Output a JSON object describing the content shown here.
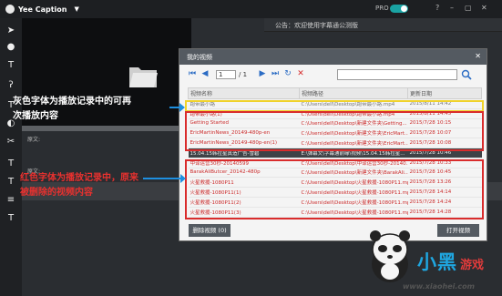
{
  "app": {
    "title": "Yee Caption",
    "pro_label": "PRO"
  },
  "notice": "公告：欢迎使用字幕通公测版",
  "subtitle_lines": {
    "line1": "原文:",
    "line2": "原文:"
  },
  "dialog": {
    "title": "我的视频",
    "page_value": "1",
    "page_total": "/ 1",
    "search_placeholder": "",
    "columns": [
      "视频名称",
      "视频路径",
      "更新日期"
    ],
    "rows": [
      {
        "name": "跑带最小路",
        "path": "C:\\Users\\dell\\Desktop\\跑带最小路.mp4",
        "date": "2015/8/11 14:42",
        "style": "gray"
      },
      {
        "name": "跑带最小路(1)",
        "path": "C:\\Users\\dell\\Desktop\\跑带最小路.mp4",
        "date": "2015/8/11 14:45",
        "style": "red"
      },
      {
        "name": "Getting Started",
        "path": "C:\\Users\\dell\\Desktop\\新建文件夹\\Getting...",
        "date": "2015/7/28 10:15",
        "style": "red"
      },
      {
        "name": "EricMartinNews_20149-480p-en",
        "path": "C:\\Users\\dell\\Desktop\\新建文件夹\\EricMart...",
        "date": "2015/7/28 10:07",
        "style": "red"
      },
      {
        "name": "EricMartinNews_20149-480p-en(1)",
        "path": "C:\\Users\\dell\\Desktop\\新建文件夹\\EricMart...",
        "date": "2015/7/28 10:08",
        "style": "red"
      },
      {
        "name": "15.04.15韩拉星真造广告-雪碧",
        "path": "E:\\弹幕文\\字幕通前缘\\视频\\15.04.15韩拉星...",
        "date": "2015/7/28 10:46",
        "style": "hl"
      },
      {
        "name": "中译运营30秒-20140599",
        "path": "C:\\Users\\dell\\Desktop\\中译运营30秒-20140...",
        "date": "2015/7/28 10:33",
        "style": "red"
      },
      {
        "name": "BarakAliButcer_20142-480p",
        "path": "C:\\Users\\dell\\Desktop\\新建文件夹\\BarakAli...",
        "date": "2015/7/28 10:45",
        "style": "red"
      },
      {
        "name": "火星救援-1080P11",
        "path": "C:\\Users\\dell\\Desktop\\火星救援-1080P11.mp4",
        "date": "2015/7/28 13:26",
        "style": "red"
      },
      {
        "name": "火星救援-1080P11(1)",
        "path": "C:\\Users\\dell\\Desktop\\火星救援-1080P11.mp4",
        "date": "2015/7/28 14:14",
        "style": "red"
      },
      {
        "name": "火星救援-1080P11(2)",
        "path": "C:\\Users\\dell\\Desktop\\火星救援-1080P11.mp4",
        "date": "2015/7/28 14:24",
        "style": "red"
      },
      {
        "name": "火星救援-1080P11(3)",
        "path": "C:\\Users\\dell\\Desktop\\火星救援-1080P11.mp4",
        "date": "2015/7/28 14:28",
        "style": "red"
      }
    ],
    "delete_button": "删除视频 (0)",
    "open_button": "打开视频"
  },
  "annotations": {
    "gray_note_1": "灰色字体为播放记录中的可再",
    "gray_note_2": "次播放内容",
    "red_note_1": "红色字体为播放记录中，原来",
    "red_note_2": "被删除的视频内容"
  },
  "watermark": {
    "brand": "小黑",
    "brand2": "游戏",
    "url": "www.xiaohei.com"
  }
}
